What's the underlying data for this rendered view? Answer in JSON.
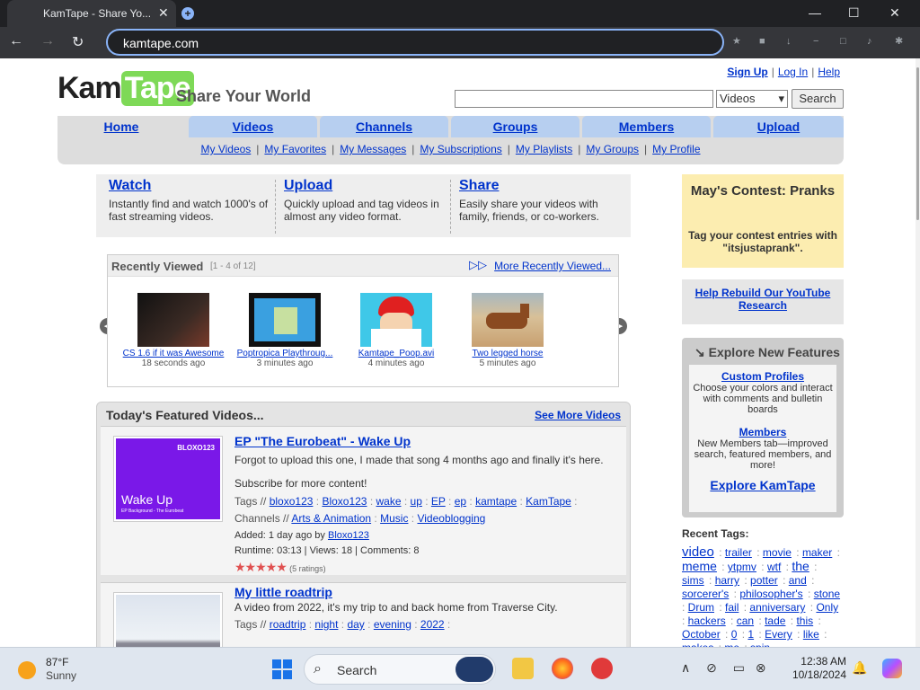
{
  "browser": {
    "tab_title": "KamTape - Share Yo...",
    "tab_close": "✕",
    "new_tab": "+",
    "url": "kamtape.com",
    "window_minimize": "—",
    "window_maximize": "☐",
    "window_close": "✕"
  },
  "site": {
    "logo_kam": "Kam",
    "logo_tape": "Tape",
    "tagline": "Share Your World",
    "top_links": [
      "Sign Up",
      "Log In",
      "Help"
    ],
    "search_placeholder": "",
    "search_category": "Videos",
    "search_button": "Search",
    "main_tabs": [
      "Home",
      "Videos",
      "Channels",
      "Groups",
      "Members",
      "Upload"
    ],
    "sub_nav": [
      "My Videos",
      "My Favorites",
      "My Messages",
      "My Subscriptions",
      "My Playlists",
      "My Groups",
      "My Profile"
    ]
  },
  "intro": [
    {
      "title": "Watch",
      "text": "Instantly find and watch 1000's of fast streaming videos."
    },
    {
      "title": "Upload",
      "text": "Quickly upload and tag videos in almost any video format."
    },
    {
      "title": "Share",
      "text": "Easily share your videos with family, friends, or co-workers."
    }
  ],
  "recently_viewed": {
    "title": "Recently Viewed",
    "count": "[1 - 4 of 12]",
    "more": "More Recently Viewed...",
    "items": [
      {
        "title": "CS 1.6 if it was Awesome",
        "ago": "18 seconds ago"
      },
      {
        "title": "Poptropica Playthroug...",
        "ago": "3 minutes ago"
      },
      {
        "title": "Kamtape_Poop.avi",
        "ago": "4 minutes ago"
      },
      {
        "title": "Two legged horse",
        "ago": "5 minutes ago"
      }
    ]
  },
  "featured": {
    "title": "Today's Featured Videos...",
    "more": "See More Videos",
    "videos": [
      {
        "title": "EP \"The Eurobeat\" - Wake Up",
        "thumb_text_top": "BLOXO123",
        "thumb_text": "Wake Up",
        "thumb_sub": "EP Background - The Eurobeat",
        "desc1": "Forgot to upload this one, I made that song 4 months ago and finally it's here.",
        "desc2": "Subscribe for more content!",
        "tags_label": "Tags //",
        "tags": [
          "bloxo123",
          "Bloxo123",
          "wake",
          "up",
          "EP",
          "ep",
          "kamtape",
          "KamTape"
        ],
        "channels_label": "Channels //",
        "channels": [
          "Arts & Animation",
          "Music",
          "Videoblogging"
        ],
        "added": "Added: 1 day ago by",
        "author": "Bloxo123",
        "stats": "Runtime: 03:13 | Views: 18 | Comments: 8",
        "stars": "★★★★★",
        "ratings": "(5 ratings)"
      },
      {
        "title": "My little roadtrip",
        "desc1": "A video from 2022, it's my trip to and back home from Traverse City.",
        "tags_label": "Tags //",
        "tags": [
          "roadtrip",
          "night",
          "day",
          "evening",
          "2022"
        ]
      }
    ]
  },
  "sidebar": {
    "contest_title": "May's Contest: Pranks",
    "contest_text": "Tag your contest entries with \"itsjustaprank\".",
    "rebuild_link": "Help Rebuild Our YouTube Research",
    "explore_title": "Explore New Features",
    "explore_arrow": "↘",
    "features": [
      {
        "title": "Custom Profiles",
        "text": "Choose your colors and interact with comments and bulletin boards"
      },
      {
        "title": "Members",
        "text": "New Members tab—improved search, featured members, and more!"
      }
    ],
    "explore_link": "Explore KamTape",
    "tags_title": "Recent Tags:",
    "recent_tags": [
      "video",
      "trailer",
      "movie",
      "maker",
      "meme",
      "ytpmv",
      "wtf",
      "the",
      "sims",
      "harry",
      "potter",
      "and",
      "sorcerer's",
      "philosopher's",
      "stone",
      "Drum",
      "fail",
      "anniversary",
      "Only",
      "hackers",
      "can",
      "tade",
      "this",
      "October",
      "0",
      "1",
      "Every",
      "like",
      "makes",
      "me",
      "spin"
    ]
  },
  "taskbar": {
    "temp": "87°F",
    "condition": "Sunny",
    "search_text": "Search",
    "time": "12:38 AM",
    "date": "10/18/2024"
  },
  "colors": {
    "link": "#0033cc",
    "tab_blue": "#b7cff0",
    "contest_bg": "#fcedb0",
    "logo_green": "#7ed957"
  }
}
